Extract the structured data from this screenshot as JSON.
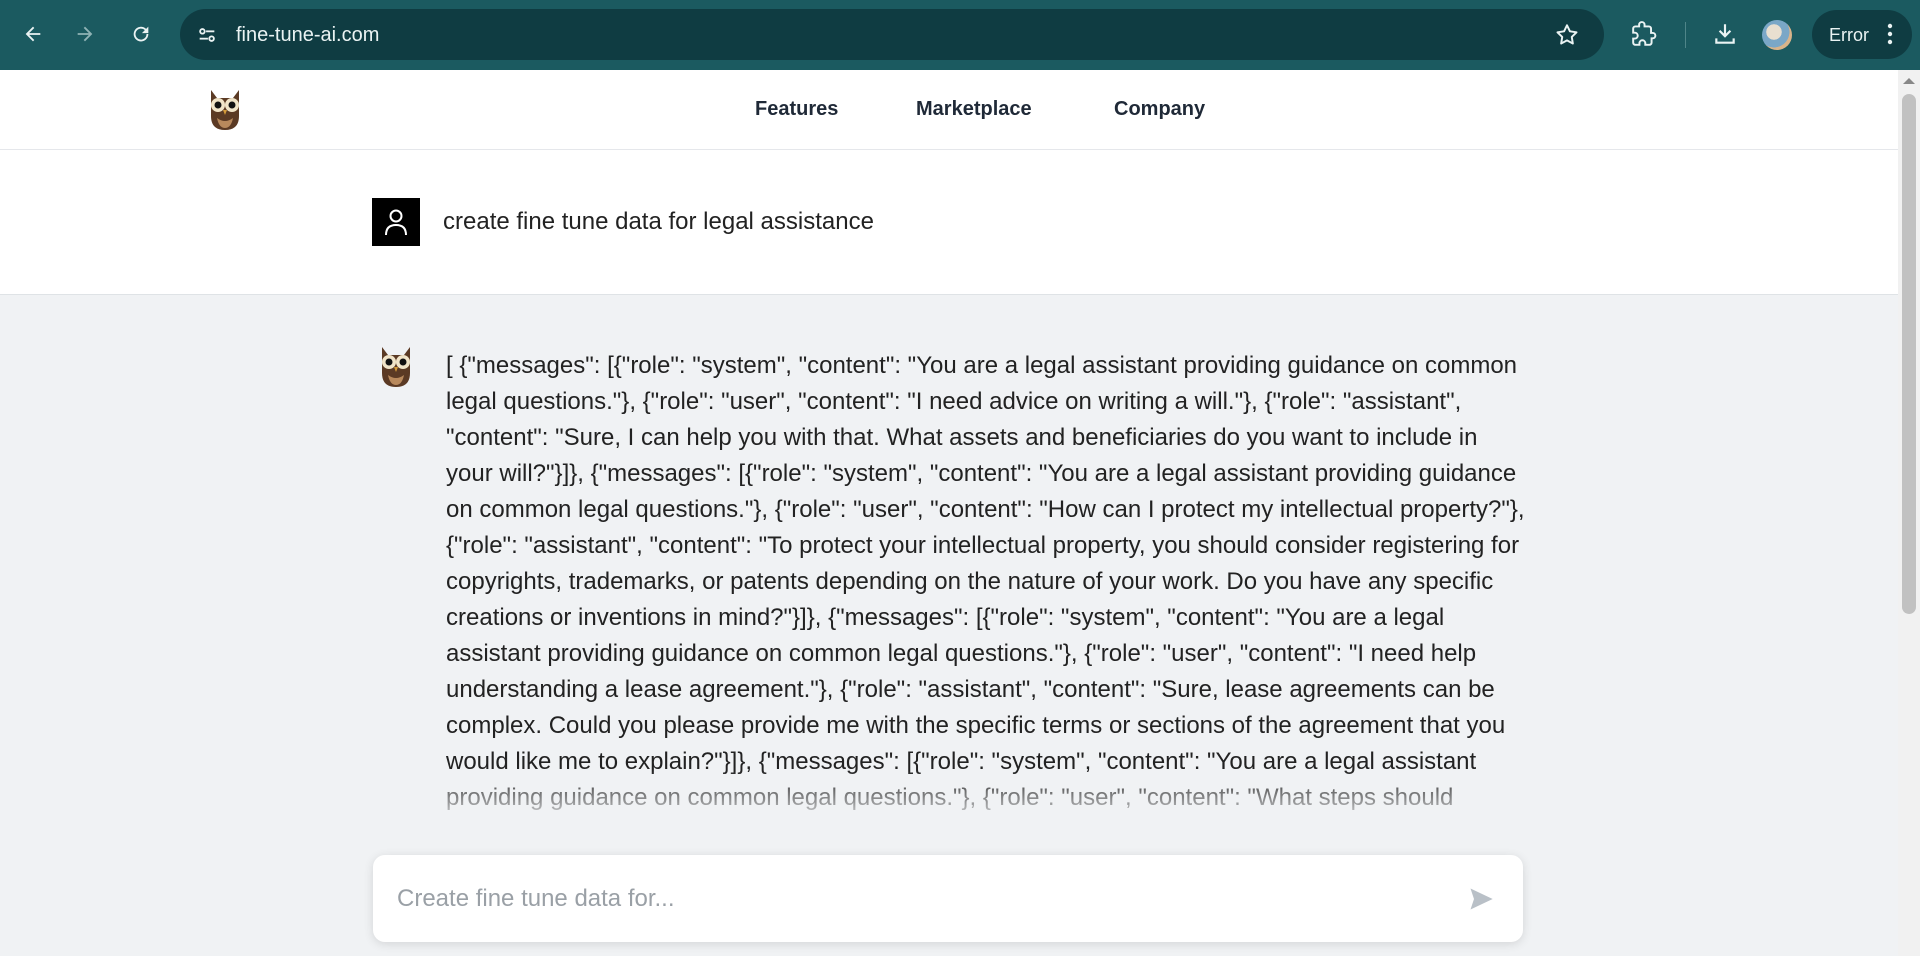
{
  "browser": {
    "url": "fine-tune-ai.com",
    "profile_status": "Error",
    "colors": {
      "chrome_bg": "#1b5a60",
      "urlbar_bg": "#0f3c42"
    },
    "icons": [
      "back-arrow-icon",
      "forward-arrow-icon",
      "reload-icon",
      "site-info-icon",
      "star-icon",
      "extensions-icon",
      "download-icon",
      "profile-avatar",
      "more-vert-icon"
    ]
  },
  "nav": {
    "logo": "owl-logo",
    "links": [
      "Features",
      "Marketplace",
      "Company"
    ]
  },
  "chat": {
    "user_message": "create fine tune data for legal assistance",
    "assistant_message": "[ {\"messages\": [{\"role\": \"system\", \"content\": \"You are a legal assistant providing guidance on common legal questions.\"}, {\"role\": \"user\", \"content\": \"I need advice on writing a will.\"}, {\"role\": \"assistant\", \"content\": \"Sure, I can help you with that. What assets and beneficiaries do you want to include in your will?\"}]}, {\"messages\": [{\"role\": \"system\", \"content\": \"You are a legal assistant providing guidance on common legal questions.\"}, {\"role\": \"user\", \"content\": \"How can I protect my intellectual property?\"}, {\"role\": \"assistant\", \"content\": \"To protect your intellectual property, you should consider registering for copyrights, trademarks, or patents depending on the nature of your work. Do you have any specific creations or inventions in mind?\"}]}, {\"messages\": [{\"role\": \"system\", \"content\": \"You are a legal assistant providing guidance on common legal questions.\"}, {\"role\": \"user\", \"content\": \"I need help understanding a lease agreement.\"}, {\"role\": \"assistant\", \"content\": \"Sure, lease agreements can be complex. Could you please provide me with the specific terms or sections of the agreement that you would like me to explain?\"}]}, {\"messages\": [{\"role\": \"system\", \"content\": \"You are a legal assistant providing guidance on common legal questions.\"}, {\"role\": \"user\", \"content\": \"What steps should",
    "input_placeholder": "Create fine tune data for...",
    "input_value": ""
  }
}
